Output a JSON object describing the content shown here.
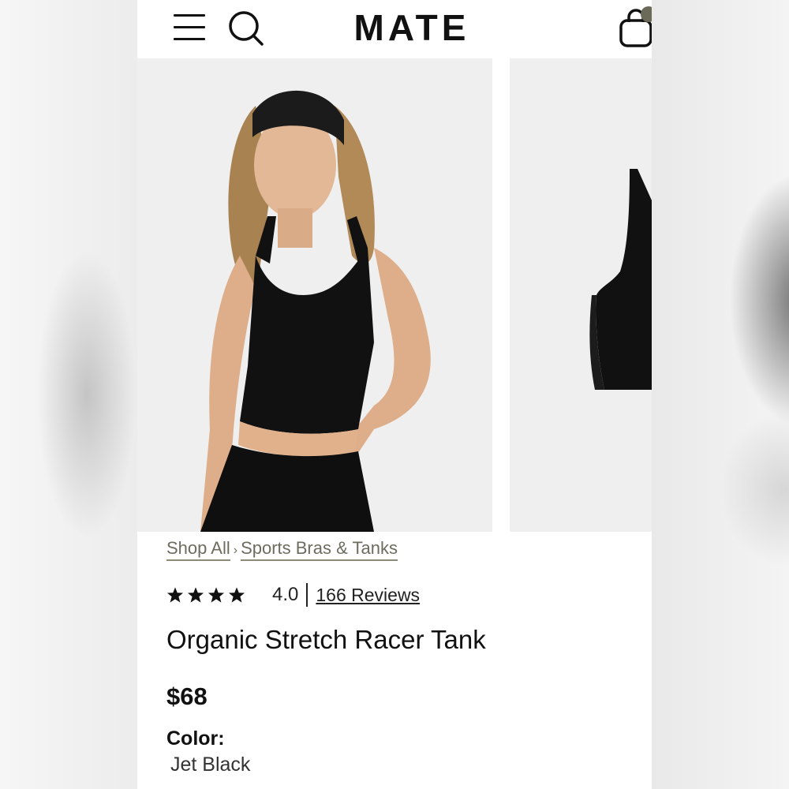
{
  "header": {
    "brand": "MATE"
  },
  "icons": {
    "menu": "hamburger-menu-icon",
    "search": "search-icon",
    "cart": "shopping-bag-icon"
  },
  "breadcrumb": {
    "items": [
      "Shop All",
      "Sports Bras & Tanks"
    ],
    "separator": "›"
  },
  "product": {
    "rating": "4.0",
    "rating_stars": 4,
    "reviews": "166 Reviews",
    "title": "Organic Stretch Racer Tank",
    "price": "$68",
    "color_label": "Color:",
    "color_value": "Jet Black"
  },
  "colors": {
    "brand_text": "#111111",
    "breadcrumb": "#6d6c5e",
    "image_bg": "#efefef"
  }
}
